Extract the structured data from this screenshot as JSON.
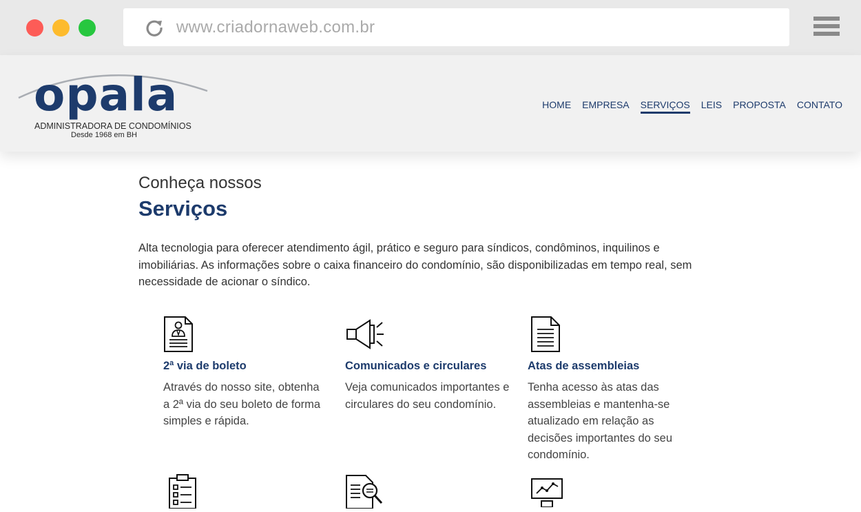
{
  "browser": {
    "url": "www.criadornaweb.com.br"
  },
  "brand": {
    "name": "opala",
    "tagline": "ADMINISTRADORA DE CONDOMÍNIOS",
    "since": "Desde 1968 em BH"
  },
  "nav": {
    "items": [
      {
        "label": "HOME"
      },
      {
        "label": "EMPRESA"
      },
      {
        "label": "SERVIÇOS"
      },
      {
        "label": "LEIS"
      },
      {
        "label": "PROPOSTA"
      },
      {
        "label": "CONTATO"
      }
    ],
    "active": "SERVIÇOS"
  },
  "services": {
    "heading_small": "Conheça nossos",
    "heading_big": "Serviços",
    "intro": "Alta tecnologia para oferecer atendimento ágil, prático e seguro para síndicos, condôminos, inquilinos e imobiliárias. As informações sobre o caixa financeiro do condomínio, são disponibilizadas em tempo real, sem necessidade de acionar o síndico.",
    "cards": [
      {
        "icon": "boleto-document-icon",
        "title": "2ª via de boleto",
        "text": "Através do nosso site, obtenha a 2ª via do seu boleto de forma simples e rápida."
      },
      {
        "icon": "megaphone-icon",
        "title": "Comunicados e circulares",
        "text": "Veja comunicados importantes e circulares do seu condomínio."
      },
      {
        "icon": "document-lines-icon",
        "title": "Atas de assembleias",
        "text": "Tenha acesso às atas das assembleias e mantenha-se atualizado em relação as decisões importantes do seu condomínio."
      }
    ]
  },
  "colors": {
    "brand_blue": "#1d3b6c",
    "text": "#333333",
    "header_bg": "#f1f1f1"
  }
}
